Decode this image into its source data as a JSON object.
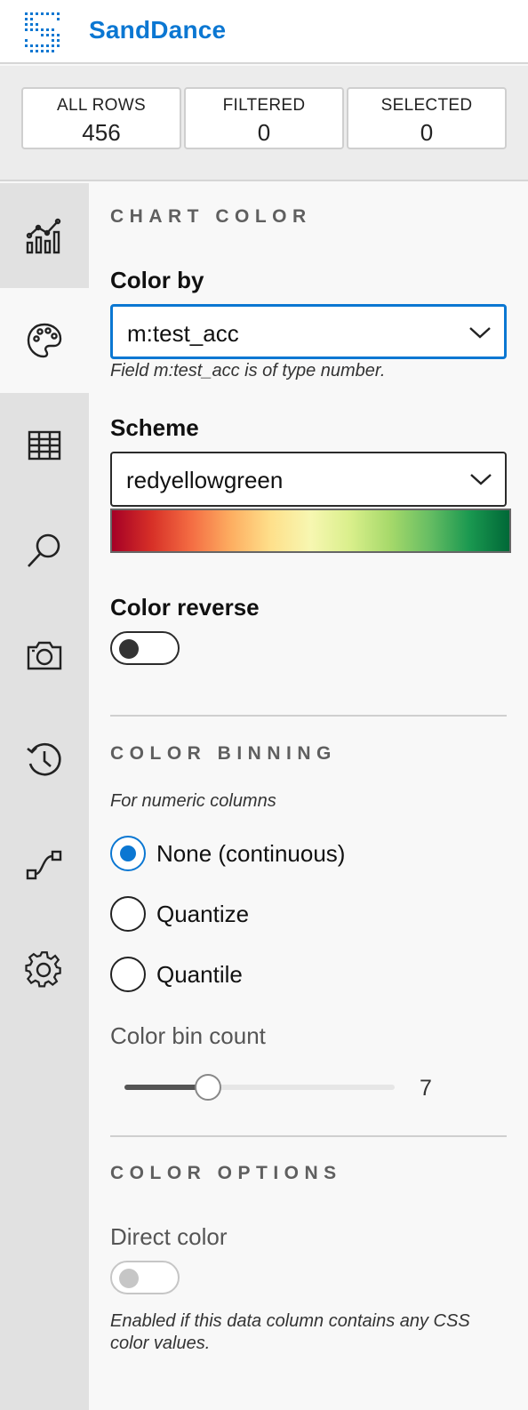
{
  "header": {
    "brand": "SandDance"
  },
  "counters": [
    {
      "label": "ALL ROWS",
      "value": "456"
    },
    {
      "label": "FILTERED",
      "value": "0"
    },
    {
      "label": "SELECTED",
      "value": "0"
    }
  ],
  "sidebar": {
    "items": [
      {
        "icon": "chart-icon",
        "active": false
      },
      {
        "icon": "palette-icon",
        "active": true
      },
      {
        "icon": "table-icon",
        "active": false
      },
      {
        "icon": "search-icon",
        "active": false
      },
      {
        "icon": "camera-icon",
        "active": false
      },
      {
        "icon": "history-icon",
        "active": false
      },
      {
        "icon": "transition-icon",
        "active": false
      },
      {
        "icon": "gear-icon",
        "active": false
      }
    ]
  },
  "chart_color": {
    "title": "CHART COLOR",
    "color_by": {
      "label": "Color by",
      "value": "m:test_acc",
      "note": "Field m:test_acc is of type number."
    },
    "scheme": {
      "label": "Scheme",
      "value": "redyellowgreen"
    },
    "reverse": {
      "label": "Color reverse",
      "on": false
    }
  },
  "color_binning": {
    "title": "COLOR BINNING",
    "note": "For numeric columns",
    "options": [
      {
        "label": "None (continuous)",
        "checked": true
      },
      {
        "label": "Quantize",
        "checked": false
      },
      {
        "label": "Quantile",
        "checked": false
      }
    ],
    "bin_count": {
      "label": "Color bin count",
      "value": "7",
      "fraction": 0.31
    }
  },
  "color_options": {
    "title": "COLOR OPTIONS",
    "direct_color": {
      "label": "Direct color",
      "on": false,
      "note": "Enabled if this data column contains any CSS color values."
    }
  },
  "colors": {
    "accent": "#0b77d2",
    "brand": "#0b77d2"
  }
}
